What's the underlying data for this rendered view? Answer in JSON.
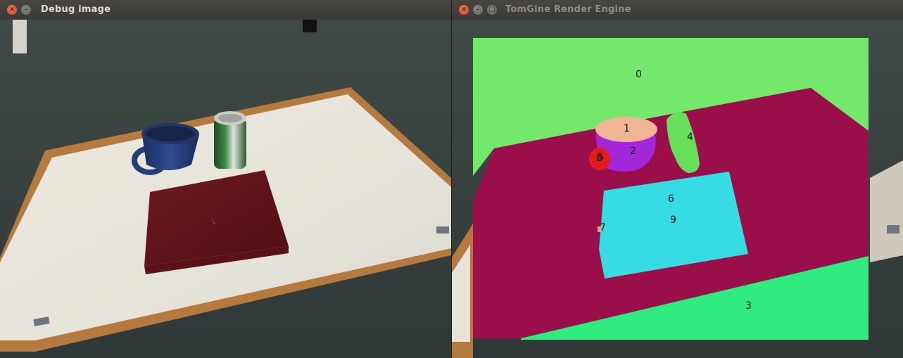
{
  "left_window": {
    "title": "Debug image",
    "close_icon": "close-icon",
    "minimize_icon": "minimize-icon"
  },
  "right_window": {
    "title": "TomGine Render Engine",
    "close_icon": "close-icon",
    "minimize_icon": "minimize-icon",
    "maximize_icon": "maximize-icon"
  },
  "segment_labels": [
    "0",
    "1",
    "2",
    "3",
    "4",
    "5",
    "6",
    "7",
    "8",
    "9"
  ],
  "colors": {
    "background_plane": "#74e86a",
    "table_surface": "#9a0f4a",
    "mug_top": "#f0b593",
    "mug_body": "#a326d8",
    "mug_handle": "#e21c1c",
    "can": "#66e05a",
    "book": "#36dbe4",
    "floor_front": "#30ec80"
  }
}
